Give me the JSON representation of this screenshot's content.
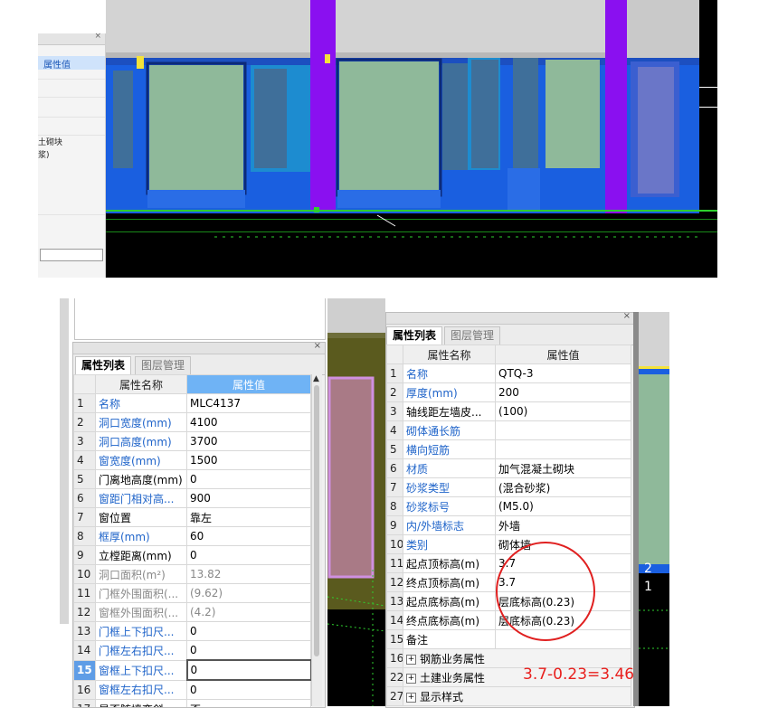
{
  "colors": {
    "panel_accent": "#6fb3f5",
    "label_blue": "#1e63c9",
    "selected_row": "#5f9de6",
    "annotation_red": "#e02020",
    "cad_background": "#000000"
  },
  "top_left_panel": {
    "highlight_label": "属性值",
    "snippet_1": "土砌块",
    "snippet_2": "浆)"
  },
  "left_panel": {
    "tabs": [
      "属性列表",
      "图层管理"
    ],
    "header": {
      "name": "属性名称",
      "value": "属性值"
    },
    "rows": [
      {
        "num": "1",
        "name": "名称",
        "value": "MLC4137",
        "style": "blue"
      },
      {
        "num": "2",
        "name": "洞口宽度(mm)",
        "value": "4100",
        "style": "blue"
      },
      {
        "num": "3",
        "name": "洞口高度(mm)",
        "value": "3700",
        "style": "blue"
      },
      {
        "num": "4",
        "name": "窗宽度(mm)",
        "value": "1500",
        "style": "blue"
      },
      {
        "num": "5",
        "name": "门离地高度(mm)",
        "value": "0",
        "style": "black"
      },
      {
        "num": "6",
        "name": "窗距门相对高...",
        "value": "900",
        "style": "blue"
      },
      {
        "num": "7",
        "name": "窗位置",
        "value": "靠左",
        "style": "black"
      },
      {
        "num": "8",
        "name": "框厚(mm)",
        "value": "60",
        "style": "blue"
      },
      {
        "num": "9",
        "name": "立樘距离(mm)",
        "value": "0",
        "style": "black"
      },
      {
        "num": "10",
        "name": "洞口面积(m²)",
        "value": "13.82",
        "style": "gray"
      },
      {
        "num": "11",
        "name": "门框外围面积(...",
        "value": "(9.62)",
        "style": "gray"
      },
      {
        "num": "12",
        "name": "窗框外围面积(...",
        "value": "(4.2)",
        "style": "gray"
      },
      {
        "num": "13",
        "name": "门框上下扣尺...",
        "value": "0",
        "style": "blue"
      },
      {
        "num": "14",
        "name": "门框左右扣尺...",
        "value": "0",
        "style": "blue"
      },
      {
        "num": "15",
        "name": "窗框上下扣尺...",
        "value": "0",
        "style": "blue",
        "selected": true
      },
      {
        "num": "16",
        "name": "窗框左右扣尺...",
        "value": "0",
        "style": "blue"
      },
      {
        "num": "17",
        "name": "是否随墙变斜",
        "value": "否",
        "style": "black"
      }
    ]
  },
  "right_panel": {
    "tabs": [
      "属性列表",
      "图层管理"
    ],
    "header": {
      "name": "属性名称",
      "value": "属性值"
    },
    "rows": [
      {
        "num": "1",
        "name": "名称",
        "value": "QTQ-3",
        "style": "blue"
      },
      {
        "num": "2",
        "name": "厚度(mm)",
        "value": "200",
        "style": "blue"
      },
      {
        "num": "3",
        "name": "轴线距左墙皮...",
        "value": "(100)",
        "style": "black"
      },
      {
        "num": "4",
        "name": "砌体通长筋",
        "value": "",
        "style": "blue"
      },
      {
        "num": "5",
        "name": "横向短筋",
        "value": "",
        "style": "blue"
      },
      {
        "num": "6",
        "name": "材质",
        "value": "加气混凝土砌块",
        "style": "blue"
      },
      {
        "num": "7",
        "name": "砂浆类型",
        "value": "(混合砂浆)",
        "style": "blue"
      },
      {
        "num": "8",
        "name": "砂浆标号",
        "value": "(M5.0)",
        "style": "blue"
      },
      {
        "num": "9",
        "name": "内/外墙标志",
        "value": "外墙",
        "style": "blue"
      },
      {
        "num": "10",
        "name": "类别",
        "value": "砌体墙",
        "style": "blue"
      },
      {
        "num": "11",
        "name": "起点顶标高(m)",
        "value": "3.7",
        "style": "black"
      },
      {
        "num": "12",
        "name": "终点顶标高(m)",
        "value": "3.7",
        "style": "black"
      },
      {
        "num": "13",
        "name": "起点底标高(m)",
        "value": "层底标高(0.23)",
        "style": "black"
      },
      {
        "num": "14",
        "name": "终点底标高(m)",
        "value": "层底标高(0.23)",
        "style": "black"
      },
      {
        "num": "15",
        "name": "备注",
        "value": "",
        "style": "black"
      }
    ],
    "groups": [
      {
        "num": "16",
        "name": "钢筋业务属性"
      },
      {
        "num": "22",
        "name": "土建业务属性"
      },
      {
        "num": "27",
        "name": "显示样式"
      }
    ]
  },
  "right_cad": {
    "label_1": "2",
    "label_2": "1"
  },
  "annotation": {
    "formula": "3.7-0.23=3.46"
  }
}
